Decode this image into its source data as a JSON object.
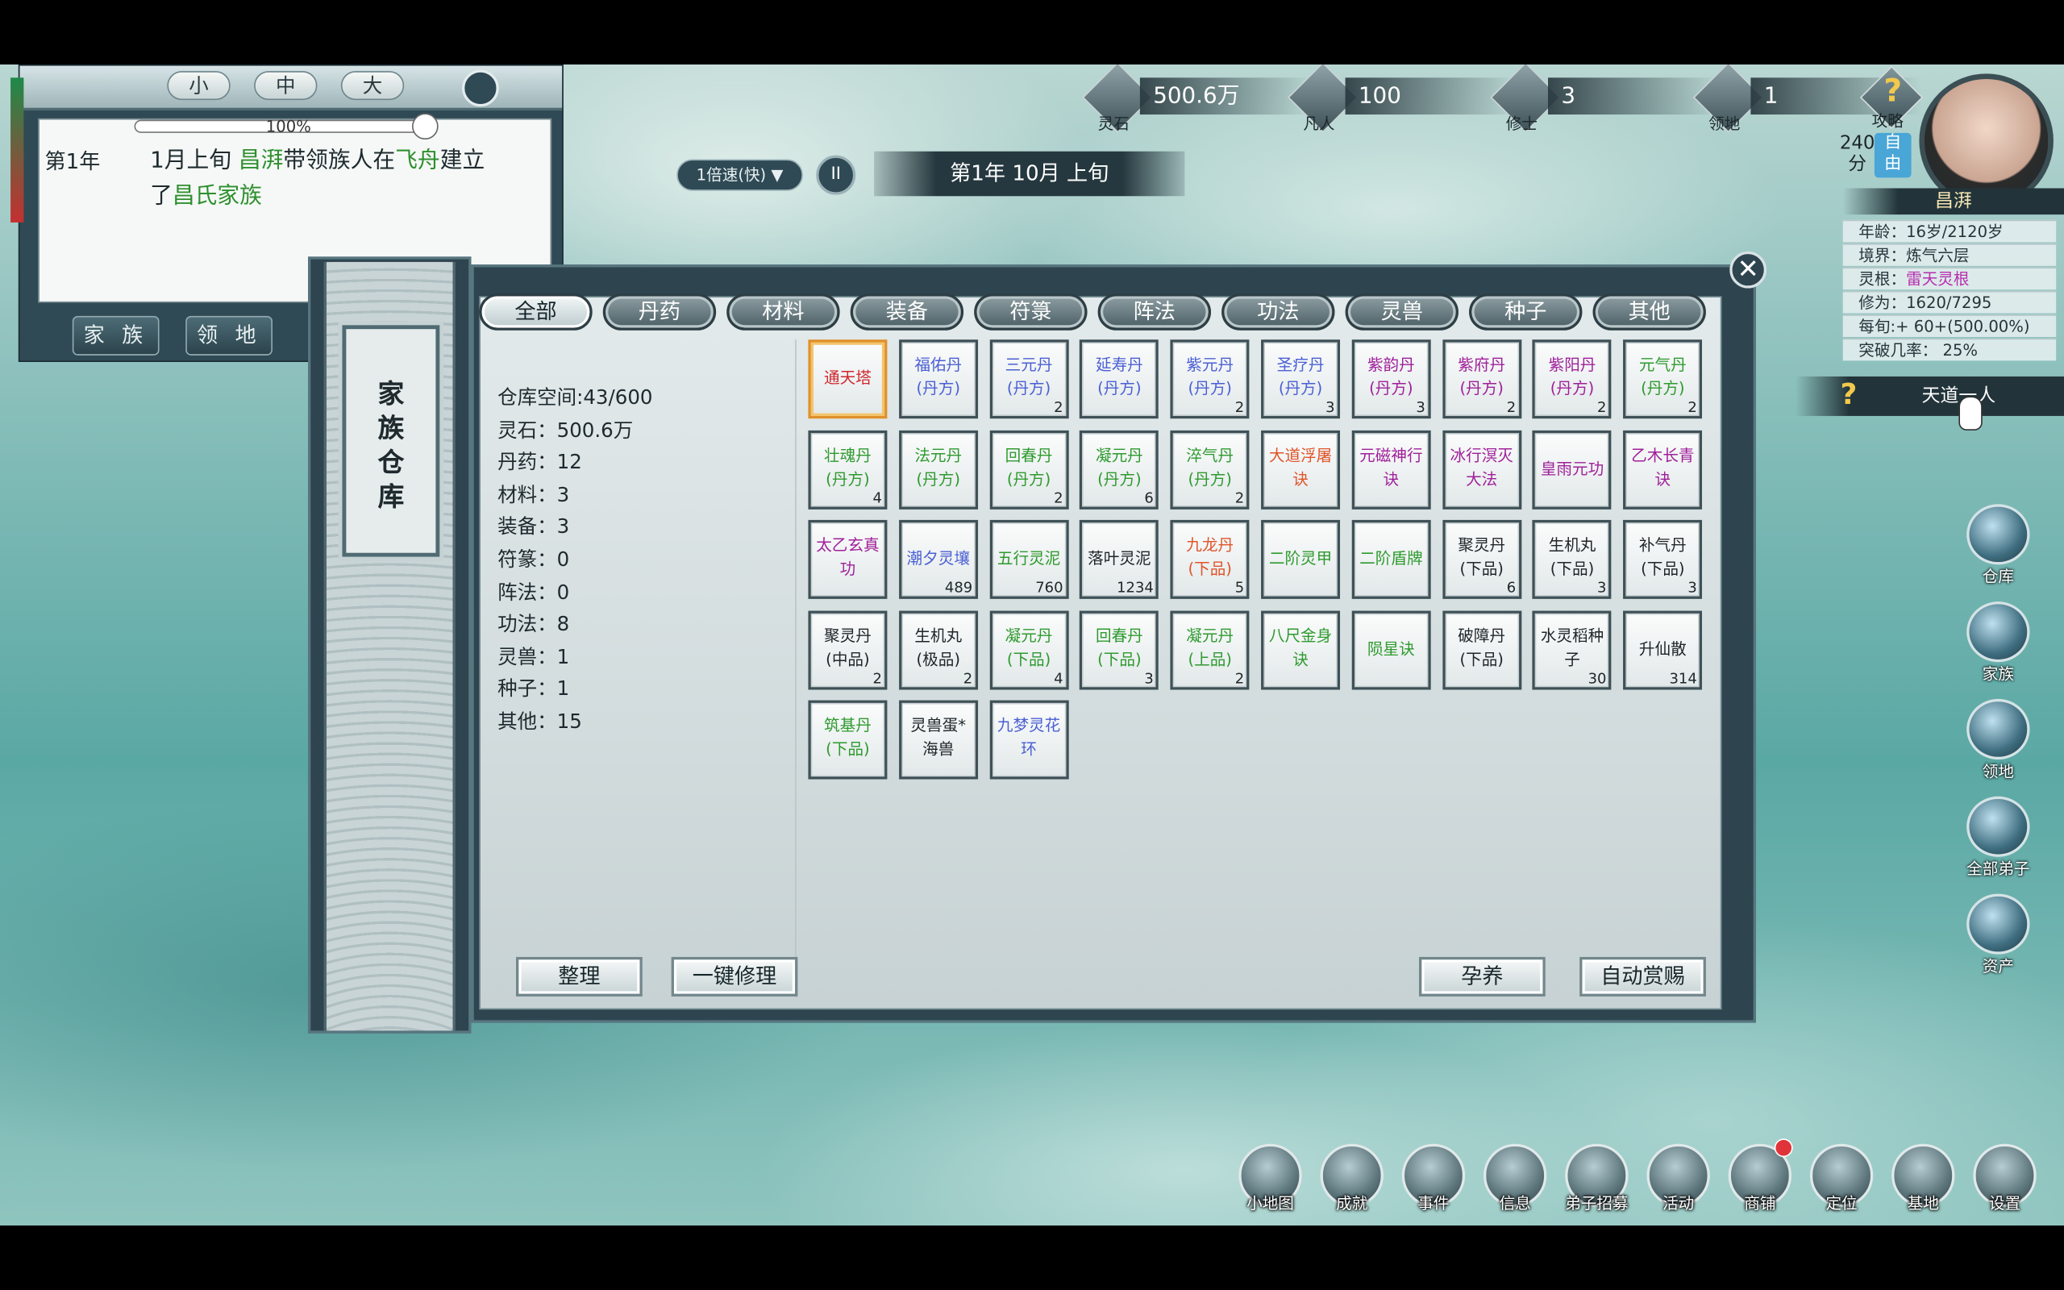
{
  "log": {
    "sizes": [
      "小",
      "中",
      "大"
    ],
    "zoom": "100%",
    "year": "第1年",
    "line1_pre": "1月上旬 ",
    "line1_name": "昌湃",
    "line1_mid": "带领族人在",
    "line1_place": "飞舟",
    "line1_post": "建立",
    "line2_pre": "了",
    "line2_clan": "昌氏家族",
    "btn_family": "家 族",
    "btn_territory": "领 地"
  },
  "resources": [
    {
      "icon": "spirit-stone-icon",
      "label": "灵石",
      "value": "500.6万"
    },
    {
      "icon": "mortal-icon",
      "label": "凡人",
      "value": "100"
    },
    {
      "icon": "cultivator-icon",
      "label": "修士",
      "value": "3"
    },
    {
      "icon": "territory-icon",
      "label": "领地",
      "value": "1"
    }
  ],
  "guide": {
    "label": "攻略",
    "q": "?"
  },
  "time": {
    "speed": "1倍速(快) ▼",
    "pause": "II",
    "date": "第1年 10月 上旬"
  },
  "character": {
    "score": "240\n分",
    "free": "自\n由",
    "name": "昌湃",
    "age": "年龄：16岁/2120岁",
    "realm": "境界：炼气六层",
    "root_label": "灵根：",
    "root_value": "雷天灵根",
    "cultivation": "修为：1620/7295",
    "per_period": "每旬:+ 60+(500.00%)",
    "breakthrough": "突破几率： 25%",
    "tiandao": "天道一人",
    "tiandao_q": "?"
  },
  "right_menu": [
    {
      "icon": "warehouse-icon",
      "label": "仓库"
    },
    {
      "icon": "family-icon",
      "label": "家族"
    },
    {
      "icon": "territory-icon",
      "label": "领地"
    },
    {
      "icon": "disciples-icon",
      "label": "全部弟子"
    },
    {
      "icon": "assets-icon",
      "label": "资产"
    }
  ],
  "bottom_menu": [
    {
      "icon": "minimap-icon",
      "label": "小地图"
    },
    {
      "icon": "achievement-icon",
      "label": "成就"
    },
    {
      "icon": "event-icon",
      "label": "事件"
    },
    {
      "icon": "mail-icon",
      "label": "信息"
    },
    {
      "icon": "recruit-icon",
      "label": "弟子招募"
    },
    {
      "icon": "activity-icon",
      "label": "活动"
    },
    {
      "icon": "shop-icon",
      "label": "商铺"
    },
    {
      "icon": "locate-icon",
      "label": "定位"
    },
    {
      "icon": "base-icon",
      "label": "基地"
    },
    {
      "icon": "settings-icon",
      "label": "设置"
    }
  ],
  "warehouse": {
    "title": "家族仓库",
    "close": "✕",
    "tabs": [
      "全部",
      "丹药",
      "材料",
      "装备",
      "符箓",
      "阵法",
      "功法",
      "灵兽",
      "种子",
      "其他"
    ],
    "active_tab": 0,
    "stats": [
      "仓库空间:43/600",
      "灵石：500.6万",
      "丹药：12",
      "材料：3",
      "装备：3",
      "符篆：0",
      "阵法：0",
      "功法：8",
      "灵兽：1",
      "种子：1",
      "其他：15"
    ],
    "items": [
      {
        "name": "通天塔",
        "count": "",
        "color": "red"
      },
      {
        "name": "福佑丹(丹方)",
        "count": "",
        "color": "blue"
      },
      {
        "name": "三元丹(丹方)",
        "count": "2",
        "color": "blue"
      },
      {
        "name": "延寿丹(丹方)",
        "count": "",
        "color": "blue"
      },
      {
        "name": "紫元丹(丹方)",
        "count": "2",
        "color": "blue"
      },
      {
        "name": "圣疗丹(丹方)",
        "count": "3",
        "color": "blue"
      },
      {
        "name": "紫韵丹(丹方)",
        "count": "3",
        "color": "purple"
      },
      {
        "name": "紫府丹(丹方)",
        "count": "2",
        "color": "purple"
      },
      {
        "name": "紫阳丹(丹方)",
        "count": "2",
        "color": "purple"
      },
      {
        "name": "元气丹(丹方)",
        "count": "2",
        "color": "green"
      },
      {
        "name": "壮魂丹(丹方)",
        "count": "4",
        "color": "green"
      },
      {
        "name": "法元丹(丹方)",
        "count": "",
        "color": "green"
      },
      {
        "name": "回春丹(丹方)",
        "count": "2",
        "color": "green"
      },
      {
        "name": "凝元丹(丹方)",
        "count": "6",
        "color": "green"
      },
      {
        "name": "淬气丹(丹方)",
        "count": "2",
        "color": "green"
      },
      {
        "name": "大道浮屠诀",
        "count": "",
        "color": "orange"
      },
      {
        "name": "元磁神行诀",
        "count": "",
        "color": "purple"
      },
      {
        "name": "冰行溟灭大法",
        "count": "",
        "color": "purple"
      },
      {
        "name": "皇雨元功",
        "count": "",
        "color": "purple"
      },
      {
        "name": "乙木长青诀",
        "count": "",
        "color": "purple"
      },
      {
        "name": "太乙玄真功",
        "count": "",
        "color": "purple"
      },
      {
        "name": "潮夕灵壤",
        "count": "489",
        "color": "blue"
      },
      {
        "name": "五行灵泥",
        "count": "760",
        "color": "green"
      },
      {
        "name": "落叶灵泥",
        "count": "1234",
        "color": "black"
      },
      {
        "name": "九龙丹(下品)",
        "count": "5",
        "color": "orange"
      },
      {
        "name": "二阶灵甲",
        "count": "",
        "color": "green"
      },
      {
        "name": "二阶盾牌",
        "count": "",
        "color": "green"
      },
      {
        "name": "聚灵丹(下品)",
        "count": "6",
        "color": "black"
      },
      {
        "name": "生机丸(下品)",
        "count": "3",
        "color": "black"
      },
      {
        "name": "补气丹(下品)",
        "count": "3",
        "color": "black"
      },
      {
        "name": "聚灵丹(中品)",
        "count": "2",
        "color": "black"
      },
      {
        "name": "生机丸(极品)",
        "count": "2",
        "color": "black"
      },
      {
        "name": "凝元丹(下品)",
        "count": "4",
        "color": "green"
      },
      {
        "name": "回春丹(下品)",
        "count": "3",
        "color": "green"
      },
      {
        "name": "凝元丹(上品)",
        "count": "2",
        "color": "green"
      },
      {
        "name": "八尺金身诀",
        "count": "",
        "color": "green"
      },
      {
        "name": "陨星诀",
        "count": "",
        "color": "green"
      },
      {
        "name": "破障丹(下品)",
        "count": "",
        "color": "black"
      },
      {
        "name": "水灵稻种子",
        "count": "30",
        "color": "black"
      },
      {
        "name": "升仙散",
        "count": "314",
        "color": "black"
      },
      {
        "name": "筑基丹(下品)",
        "count": "",
        "color": "green"
      },
      {
        "name": "灵兽蛋*海兽",
        "count": "",
        "color": "black"
      },
      {
        "name": "九梦灵花环",
        "count": "",
        "color": "blue"
      }
    ],
    "buttons": {
      "sort": "整理",
      "repair": "一键修理",
      "nurture": "孕养",
      "auto_reward": "自动赏赐"
    }
  }
}
